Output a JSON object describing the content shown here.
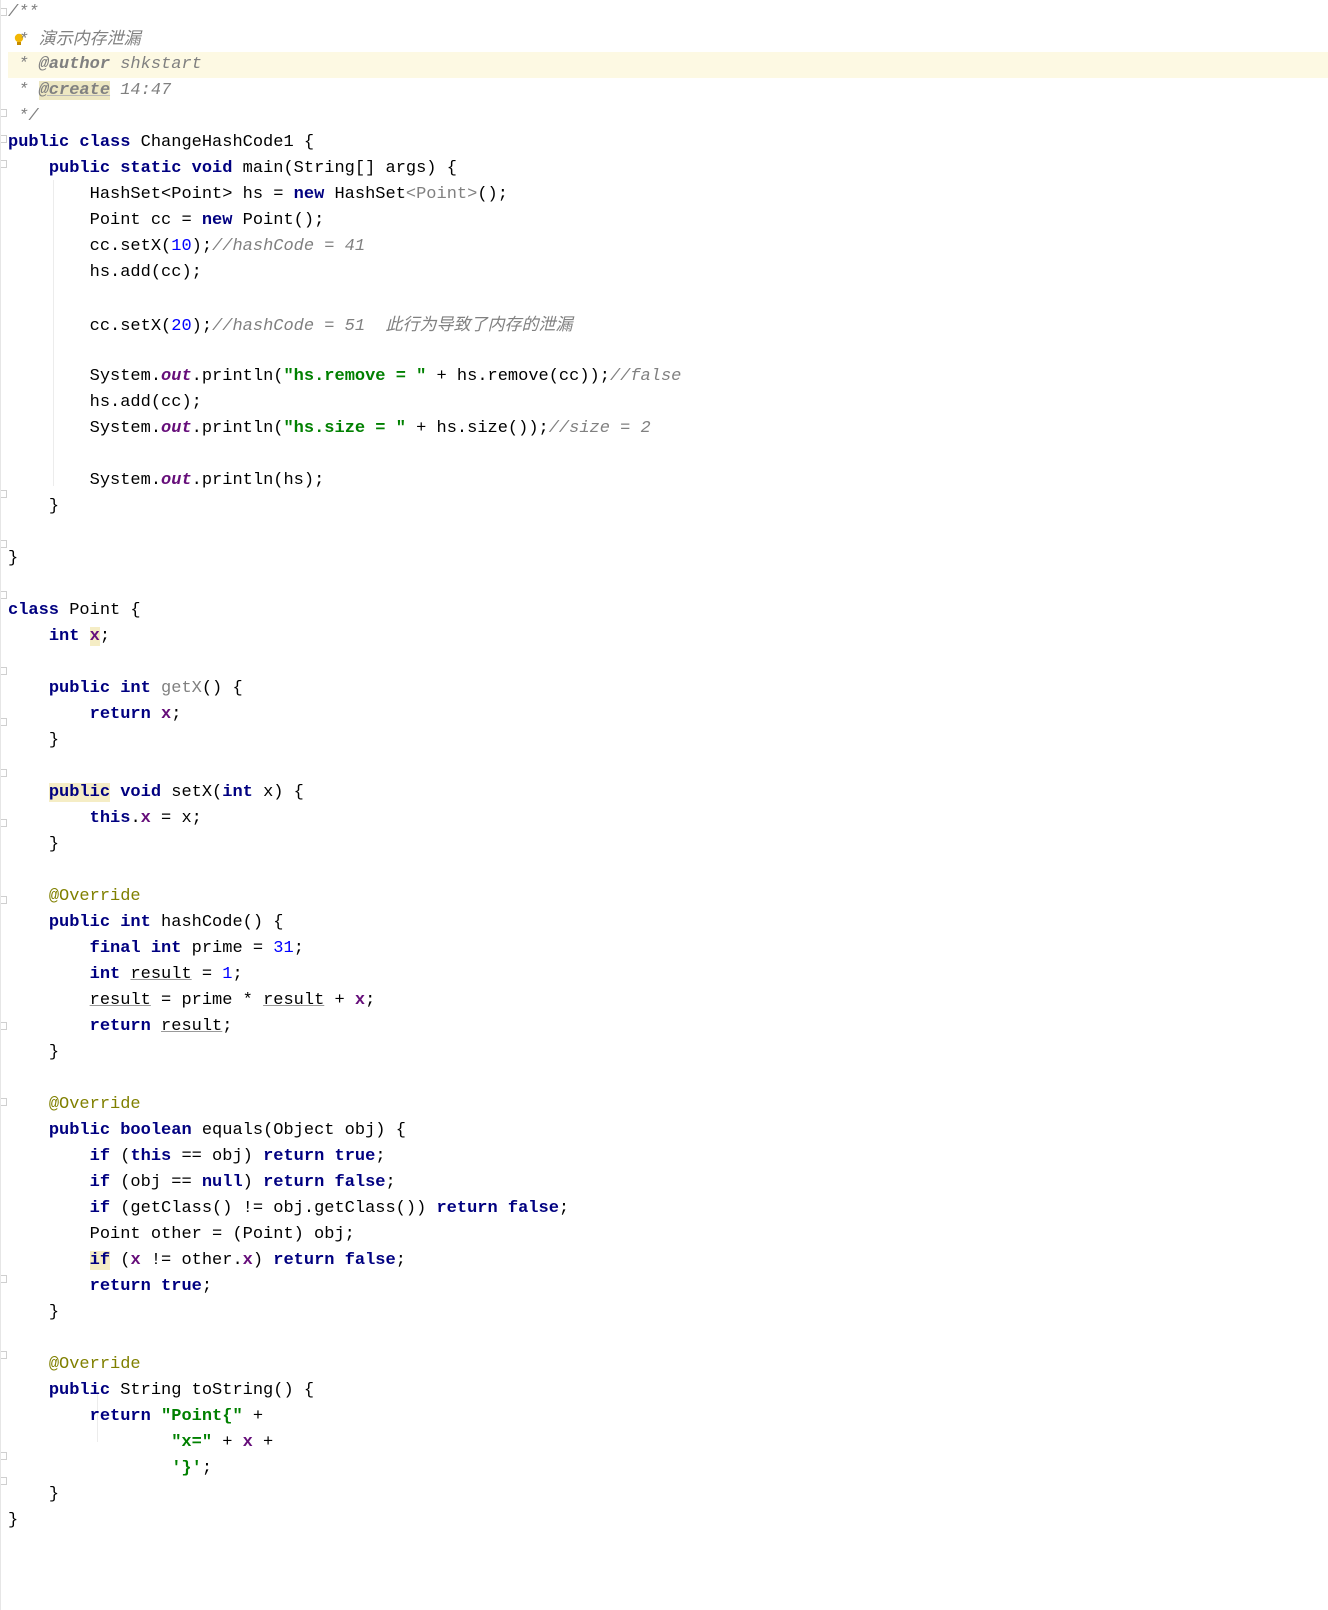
{
  "editor": {
    "language": "java",
    "colors": {
      "keyword": "#000080",
      "comment": "#808080",
      "string": "#008000",
      "number": "#0000ff",
      "field": "#660e7a",
      "annotation": "#808000",
      "caret_line": "#fdf9e3"
    },
    "icons": [
      "intention-bulb-icon",
      "fold-marker-icon"
    ],
    "lines": [
      "/**",
      " * 演示内存泄漏",
      " * @author shkstart",
      " * @create 14:47",
      " */",
      "public class ChangeHashCode1 {",
      "    public static void main(String[] args) {",
      "        HashSet<Point> hs = new HashSet<Point>();",
      "        Point cc = new Point();",
      "        cc.setX(10);//hashCode = 41",
      "        hs.add(cc);",
      "",
      "        cc.setX(20);//hashCode = 51  此行为导致了内存的泄漏",
      "",
      "        System.out.println(\"hs.remove = \" + hs.remove(cc));//false",
      "        hs.add(cc);",
      "        System.out.println(\"hs.size = \" + hs.size());//size = 2",
      "",
      "        System.out.println(hs);",
      "    }",
      "",
      "}",
      "",
      "class Point {",
      "    int x;",
      "",
      "    public int getX() {",
      "        return x;",
      "    }",
      "",
      "    public void setX(int x) {",
      "        this.x = x;",
      "    }",
      "",
      "    @Override",
      "    public int hashCode() {",
      "        final int prime = 31;",
      "        int result = 1;",
      "        result = prime * result + x;",
      "        return result;",
      "    }",
      "",
      "    @Override",
      "    public boolean equals(Object obj) {",
      "        if (this == obj) return true;",
      "        if (obj == null) return false;",
      "        if (getClass() != obj.getClass()) return false;",
      "        Point other = (Point) obj;",
      "        if (x != other.x) return false;",
      "        return true;",
      "    }",
      "",
      "    @Override",
      "    public String toString() {",
      "        return \"Point{\" +",
      "                \"x=\" + x +",
      "                '}';",
      "    }",
      "}"
    ],
    "tokens": {
      "doc_open": "/**",
      "doc_star": " * ",
      "doc_title": "演示内存泄漏",
      "author_tag": "@author",
      "author_value": " shkstart",
      "create_tag": "@create",
      "create_value": " 14:47",
      "doc_close": " */",
      "kw_public": "public",
      "kw_class": "class",
      "kw_static": "static",
      "kw_void": "void",
      "kw_new": "new",
      "kw_int": "int",
      "kw_return": "return",
      "kw_this": "this",
      "kw_final": "final",
      "kw_boolean": "boolean",
      "kw_if": "if",
      "kw_true": "true",
      "kw_false": "false",
      "kw_null": "null",
      "class_name_main": " ChangeHashCode1 {",
      "main_sig": " main(String[] args) {",
      "hs_decl_a": "HashSet<Point> hs = ",
      "hs_decl_b": " HashSet",
      "hs_decl_gen": "<Point>",
      "hs_decl_c": "();",
      "cc_decl_a": "Point cc = ",
      "cc_decl_b": " Point();",
      "setx_call": "cc.setX(",
      "num_10": "10",
      "num_20": "20",
      "call_close": ");",
      "cmt_hash41": "//hashCode = 41",
      "cmt_hash51": "//hashCode = 51  ",
      "cmt_leak": "此行为导致了内存的泄漏",
      "hs_add": "hs.add(cc);",
      "sys": "System.",
      "out": "out",
      "println_open": ".println(",
      "str_remove": "\"hs.remove = \"",
      "remove_tail": " + hs.remove(cc));",
      "cmt_false": "//false",
      "str_size": "\"hs.size = \"",
      "size_tail": " + hs.size());",
      "cmt_size": "//size = 2",
      "println_hs": ".println(hs);",
      "brace_close": "}",
      "class_point": " Point {",
      "x": "x",
      "semicolon": ";",
      "getx_name": " getX",
      "getx_tail": "() {",
      "setx_sig_a": " setX(",
      "setx_sig_b": " x) {",
      "dot": ".",
      "assign_x": " = x;",
      "override": "@Override",
      "hashcode_sig": " hashCode() {",
      "prime_decl": " prime = ",
      "num_31": "31",
      "result": "result",
      "result_init": " = ",
      "num_1": "1",
      "result_expr_a": " = prime * ",
      "plus": " + ",
      "return_result": "result",
      "equals_sig": " equals(Object obj) {",
      "if_this_a": " (",
      "if_this_b": " == obj) ",
      "if_null_a": " (obj == ",
      "if_null_b": ") ",
      "if_class": " (getClass() != obj.getClass()) ",
      "point_other": "Point other = (Point) obj;",
      "if_x_a": " (",
      "if_x_b": " != other.",
      "if_x_c": ") ",
      "tostring_sig": " String toString() {",
      "str_point": "\"Point{\"",
      "plus_end": " +",
      "str_x": "\"x=\"",
      "char_brace": "'}'"
    }
  }
}
